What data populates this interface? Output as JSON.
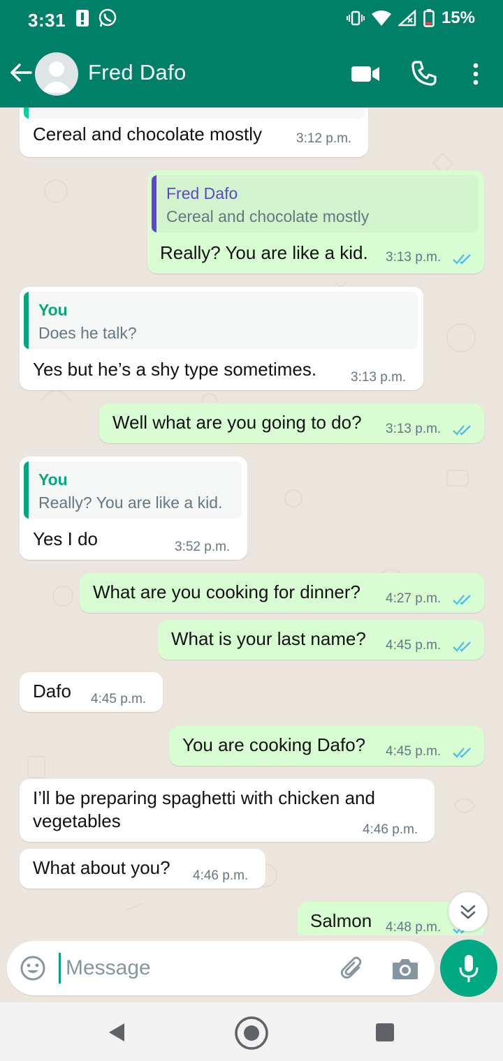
{
  "status_bar": {
    "time": "3:31",
    "battery": "15%"
  },
  "header": {
    "contact_name": "Fred Dafo"
  },
  "colors": {
    "header": "#008069",
    "accent": "#00a884",
    "outgoing_bubble": "#d9fdd3",
    "tick_read": "#53bdeb"
  },
  "messages": [
    {
      "direction": "in",
      "text": "Cereal and chocolate mostly",
      "time": "3:12 p.m."
    },
    {
      "direction": "out",
      "quote_author": "Fred Dafo",
      "quote_text": "Cereal and chocolate mostly",
      "text": "Really? You are like a kid.",
      "time": "3:13 p.m."
    },
    {
      "direction": "in",
      "quote_author": "You",
      "quote_text": "Does he talk?",
      "text": "Yes but he’s a shy type sometimes.",
      "time": "3:13 p.m."
    },
    {
      "direction": "out",
      "text": "Well what are you going to do?",
      "time": "3:13 p.m."
    },
    {
      "direction": "in",
      "quote_author": "You",
      "quote_text": "Really? You are like a kid.",
      "text": "Yes I do",
      "time": "3:52 p.m."
    },
    {
      "direction": "out",
      "text": "What are you cooking for dinner?",
      "time": "4:27 p.m."
    },
    {
      "direction": "out",
      "text": "What is your last name?",
      "time": "4:45 p.m."
    },
    {
      "direction": "in",
      "text": "Dafo",
      "time": "4:45 p.m."
    },
    {
      "direction": "out",
      "text": "You are cooking Dafo?",
      "time": "4:45 p.m."
    },
    {
      "direction": "in",
      "text_line1": "I’ll be preparing spaghetti with chicken and",
      "text_line2": "vegetables",
      "time": "4:46 p.m."
    },
    {
      "direction": "in",
      "text": "What about you?",
      "time": "4:46 p.m."
    },
    {
      "direction": "out",
      "text": "Salmon",
      "time": "4:48 p.m."
    }
  ],
  "composer": {
    "placeholder": "Message"
  },
  "icons": [
    "back-arrow-icon",
    "avatar-icon",
    "video-call-icon",
    "phone-icon",
    "more-vert-icon",
    "emoji-icon",
    "attach-icon",
    "camera-icon",
    "mic-icon",
    "double-chevron-down-icon",
    "double-tick-icon"
  ]
}
